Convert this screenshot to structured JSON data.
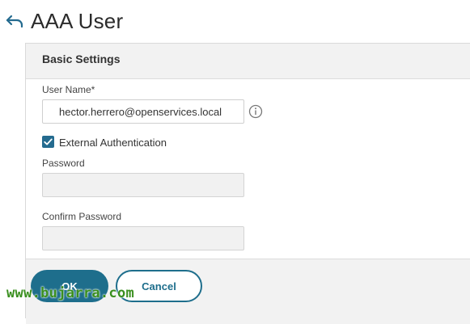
{
  "header": {
    "title": "AAA User",
    "back_icon": "back-arrow-icon"
  },
  "panel": {
    "title": "Basic Settings",
    "user_name": {
      "label": "User Name*",
      "value": "hector.herrero@openservices.local",
      "info_icon": "info-icon"
    },
    "external_auth": {
      "label": "External Authentication",
      "checked": true
    },
    "password": {
      "label": "Password",
      "value": ""
    },
    "confirm_password": {
      "label": "Confirm Password",
      "value": ""
    }
  },
  "buttons": {
    "ok_label": "OK",
    "cancel_label": "Cancel"
  },
  "watermark": "www.bujarra.com",
  "colors": {
    "accent": "#1e6e8c",
    "checkbox": "#246b8f",
    "watermark": "#3a8f1f"
  }
}
